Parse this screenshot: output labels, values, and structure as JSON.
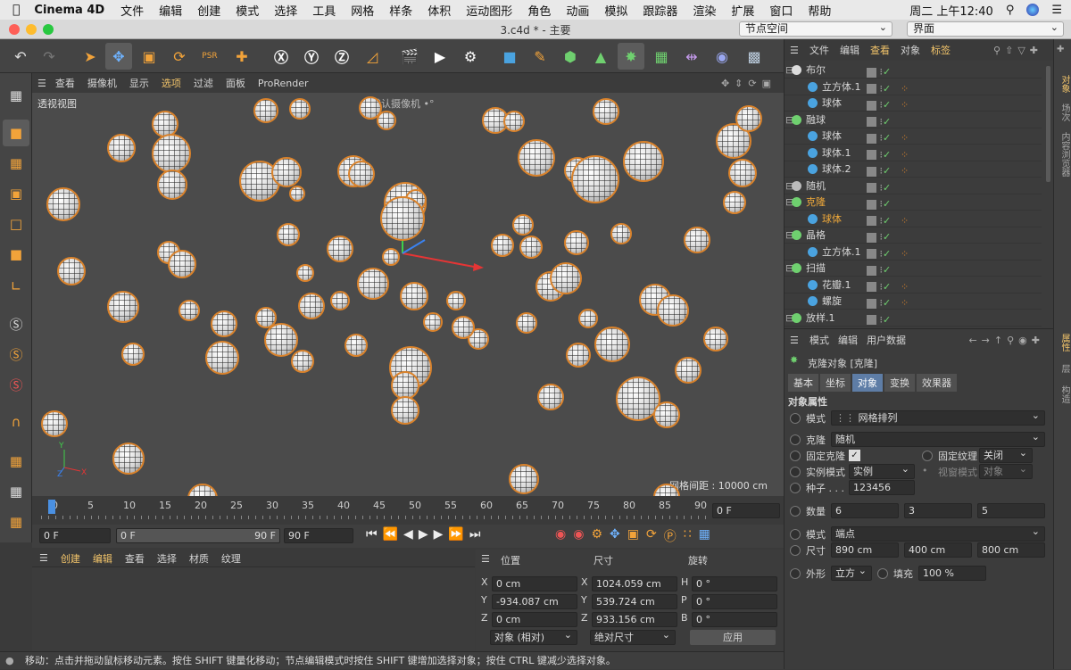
{
  "menubar": {
    "app": "Cinema 4D",
    "items": [
      "文件",
      "编辑",
      "创建",
      "模式",
      "选择",
      "工具",
      "网格",
      "样条",
      "体积",
      "运动图形",
      "角色",
      "动画",
      "模拟",
      "跟踪器",
      "渲染",
      "扩展",
      "窗口",
      "帮助"
    ],
    "clock": "周二 上午12:40"
  },
  "window": {
    "title": "3.c4d * - 主要",
    "node_space": "节点空间",
    "layout": "界面"
  },
  "viewport": {
    "menu": [
      "查看",
      "摄像机",
      "显示",
      "选项",
      "过滤",
      "面板",
      "ProRender"
    ],
    "label": "透视视图",
    "camera": "默认摄像机 •°",
    "grid_spacing": "网格间距 : 10000 cm"
  },
  "timeline": {
    "ticks": [
      "0",
      "5",
      "10",
      "15",
      "20",
      "25",
      "30",
      "35",
      "40",
      "45",
      "50",
      "55",
      "60",
      "65",
      "70",
      "75",
      "80",
      "85",
      "90"
    ],
    "current": "0 F",
    "start": "0 F",
    "range_start": "0 F",
    "range_end": "90 F",
    "end": "90 F"
  },
  "material_panel": {
    "menu": [
      "创建",
      "编辑",
      "查看",
      "选择",
      "材质",
      "纹理"
    ]
  },
  "coords": {
    "headers": [
      "位置",
      "尺寸",
      "旋转"
    ],
    "rows": [
      {
        "axis": "X",
        "pos": "0 cm",
        "size_axis": "X",
        "size": "1024.059 cm",
        "rot_axis": "H",
        "rot": "0 °"
      },
      {
        "axis": "Y",
        "pos": "-934.087 cm",
        "size_axis": "Y",
        "size": "539.724 cm",
        "rot_axis": "P",
        "rot": "0 °"
      },
      {
        "axis": "Z",
        "pos": "0 cm",
        "size_axis": "Z",
        "size": "933.156 cm",
        "rot_axis": "B",
        "rot": "0 °"
      }
    ],
    "mode": "对象 (相对)",
    "size_mode": "绝对尺寸",
    "apply": "应用"
  },
  "status": "移动：点击并拖动鼠标移动元素。按住 SHIFT 键量化移动；节点编辑模式时按住 SHIFT 键增加选择对象；按住 CTRL 键减少选择对象。",
  "object_manager": {
    "menu": [
      "文件",
      "编辑",
      "查看",
      "对象",
      "标签"
    ],
    "objects": [
      {
        "name": "布尔",
        "color": "#dcdcdc",
        "indent": 0
      },
      {
        "name": "立方体.1",
        "color": "#4aa3e0",
        "indent": 1
      },
      {
        "name": "球体",
        "color": "#4aa3e0",
        "indent": 1
      },
      {
        "name": "融球",
        "color": "#6fd06f",
        "indent": 0
      },
      {
        "name": "球体",
        "color": "#4aa3e0",
        "indent": 1
      },
      {
        "name": "球体.1",
        "color": "#4aa3e0",
        "indent": 1
      },
      {
        "name": "球体.2",
        "color": "#4aa3e0",
        "indent": 1
      },
      {
        "name": "随机",
        "color": "#bbbbbb",
        "indent": 0
      },
      {
        "name": "克隆",
        "color": "#6fd06f",
        "indent": 0,
        "highlight": true
      },
      {
        "name": "球体",
        "color": "#4aa3e0",
        "indent": 1,
        "highlight": true
      },
      {
        "name": "晶格",
        "color": "#6fd06f",
        "indent": 0
      },
      {
        "name": "立方体.1",
        "color": "#4aa3e0",
        "indent": 1
      },
      {
        "name": "扫描",
        "color": "#6fd06f",
        "indent": 0
      },
      {
        "name": "花瓣.1",
        "color": "#4aa3e0",
        "indent": 1
      },
      {
        "name": "螺旋",
        "color": "#4aa3e0",
        "indent": 1
      },
      {
        "name": "放样.1",
        "color": "#6fd06f",
        "indent": 0
      }
    ]
  },
  "attributes": {
    "menu": [
      "模式",
      "编辑",
      "用户数据"
    ],
    "object_title": "克隆对象 [克隆]",
    "tabs": [
      "基本",
      "坐标",
      "对象",
      "变换",
      "效果器"
    ],
    "active_tab": "对象",
    "section": "对象属性",
    "mode_label": "模式",
    "mode_value": "网格排列",
    "clone_label": "克隆",
    "clone_value": "随机",
    "fix_clone_label": "固定克隆",
    "fix_texture_label": "固定纹理",
    "fix_texture_value": "关闭",
    "instance_label": "实例模式",
    "instance_value": "实例",
    "viewport_instance_label": "视窗模式",
    "viewport_instance_value": "对象",
    "seed_label": "种子 . . .",
    "seed_value": "123456",
    "count_label": "数量",
    "count": [
      "6",
      "3",
      "5"
    ],
    "mode2_label": "模式",
    "mode2_value": "端点",
    "size_label": "尺寸",
    "size": [
      "890 cm",
      "400 cm",
      "800 cm"
    ],
    "shape_label": "外形",
    "shape_value": "立方",
    "fill_label": "填充",
    "fill_value": "100 %"
  },
  "side_tabs": [
    "对象",
    "场次",
    "内容浏览器",
    "属性",
    "层",
    "构造"
  ],
  "colors": {
    "accent": "#d9822b",
    "highlight": "#f0a93a",
    "selection_blue": "#5e7da6"
  }
}
